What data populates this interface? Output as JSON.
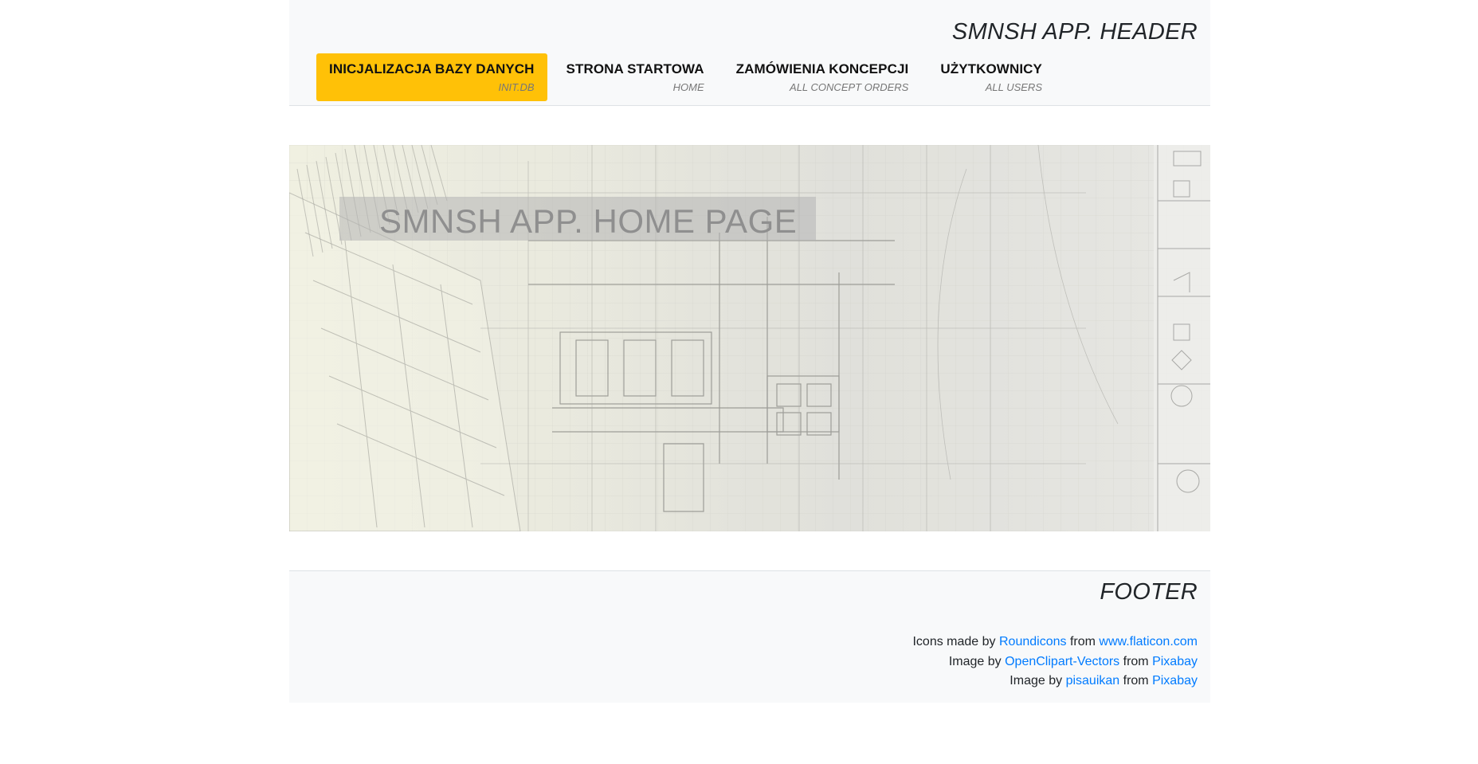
{
  "header": {
    "title": "SMNSH APP. HEADER",
    "nav": [
      {
        "label": "INICJALIZACJA BAZY DANYCH",
        "sub": "INIT.DB",
        "active": true
      },
      {
        "label": "STRONA STARTOWA",
        "sub": "HOME",
        "active": false
      },
      {
        "label": "ZAMÓWIENIA KONCEPCJI",
        "sub": "ALL CONCEPT ORDERS",
        "active": false
      },
      {
        "label": "UŻYTKOWNICY",
        "sub": "ALL USERS",
        "active": false
      }
    ]
  },
  "hero": {
    "title": "SMNSH APP. HOME PAGE"
  },
  "footer": {
    "title": "FOOTER",
    "credits": [
      {
        "prefix": "Icons made by",
        "author": "Roundicons",
        "middle": "from",
        "source": "www.flaticon.com"
      },
      {
        "prefix": "Image by",
        "author": "OpenClipart-Vectors",
        "middle": "from",
        "source": "Pixabay"
      },
      {
        "prefix": "Image by",
        "author": "pisauikan",
        "middle": "from",
        "source": "Pixabay"
      }
    ]
  },
  "colors": {
    "active_nav": "#ffc107",
    "link": "#007bff",
    "panel": "#f8f9fa"
  }
}
